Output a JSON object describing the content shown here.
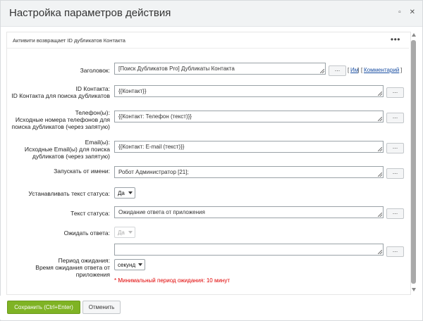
{
  "dialog": {
    "title": "Настройка параметров действия",
    "section_title": "Активити возвращает ID дубликатов Контакта",
    "section_menu": "•••"
  },
  "window_icons": [
    "▫",
    "✕"
  ],
  "fields": {
    "header": {
      "label": "Заголовок:",
      "value": "[Поиск Дубликатов Pro] Дубликаты Контакта"
    },
    "contact_id": {
      "label": "ID Контакта:",
      "sublabel": "ID Контакта для поиска дубликатов",
      "value": "{{Контакт}}"
    },
    "phones": {
      "label": "Телефон(ы):",
      "sublabel1": "Исходные номера телефонов для",
      "sublabel2": "поиска дубликатов (через запятую)",
      "value": "{{Контакт: Телефон (текст)}}"
    },
    "emails": {
      "label": "Email(ы):",
      "sublabel1": "Исходные Email(ы) для поиска",
      "sublabel2": "дубликатов (через запятую)",
      "value": "{{Контакт: E-mail (текст)}}"
    },
    "run_as": {
      "label": "Запускать от имени:",
      "value": "Робот Администратор [21];"
    },
    "set_status": {
      "label": "Устанавливать текст статуса:",
      "value": "Да"
    },
    "status_text": {
      "label": "Текст статуса:",
      "value": "Ожидание ответа от приложения"
    },
    "wait_answer": {
      "label": "Ожидать ответа:",
      "value": "Да"
    },
    "wait_period": {
      "label": "Период ожидания:",
      "sublabel1": "Время ожидания ответа от",
      "sublabel2": "приложения",
      "value": "",
      "unit": "секунд",
      "note": "* Минимальный период ожидания: 10 минут"
    }
  },
  "links": {
    "name_open": "[",
    "name": "Им",
    "name_close": "]",
    "comment_open": "[",
    "comment": "Комментарий",
    "comment_close": "]"
  },
  "dots_label": "...",
  "footer": {
    "save_label": "Сохранить (Ctrl+Enter)",
    "cancel_label": "Отменить"
  }
}
